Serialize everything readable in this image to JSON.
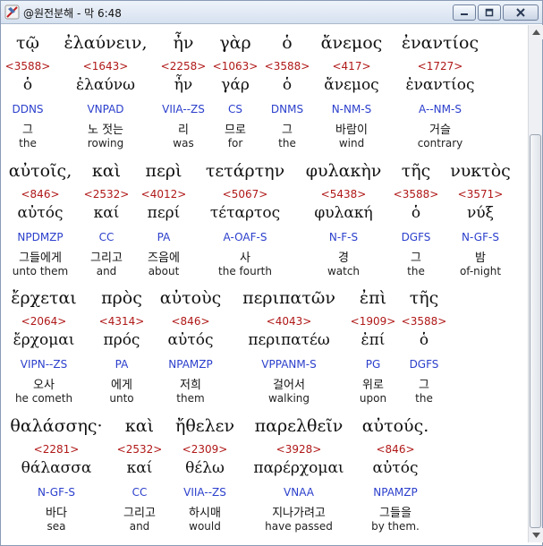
{
  "window": {
    "title": "@원전분해 - 막 6:48",
    "minimize_glyph": "▁",
    "maximize_glyph": "□",
    "close_glyph": "✕"
  },
  "colors": {
    "strong": "#b01818",
    "parsing": "#2b3fcc",
    "text": "#111111"
  },
  "icons": {
    "app": "app-logo-icon",
    "scroll_up": "scroll-up-arrow-icon",
    "scroll_down": "scroll-down-arrow-icon"
  },
  "verse": {
    "rows": [
      {
        "words": [
          {
            "greek": "τῷ",
            "strong": "<3588>",
            "lemma": "ὁ",
            "parse": "DDNS",
            "korean": "그",
            "english": "the"
          },
          {
            "greek": "ἐλαύνειν,",
            "strong": "<1643>",
            "lemma": "ἐλαύνω",
            "parse": "VNPAD",
            "korean": "노 젓는",
            "english": "rowing"
          },
          {
            "greek": "ἦν",
            "strong": "<2258>",
            "lemma": "ἦν",
            "parse": "VIIA--ZS",
            "korean": "리",
            "english": "was"
          },
          {
            "greek": "γὰρ",
            "strong": "<1063>",
            "lemma": "γάρ",
            "parse": "CS",
            "korean": "므로",
            "english": "for"
          },
          {
            "greek": "ὁ",
            "strong": "<3588>",
            "lemma": "ὁ",
            "parse": "DNMS",
            "korean": "그",
            "english": "the"
          },
          {
            "greek": "ἄνεμος",
            "strong": "<417>",
            "lemma": "ἄνεμος",
            "parse": "N-NM-S",
            "korean": "바람이",
            "english": "wind"
          },
          {
            "greek": "ἐναντίος",
            "strong": "<1727>",
            "lemma": "ἐναντίος",
            "parse": "A--NM-S",
            "korean": "거슬",
            "english": "contrary"
          }
        ]
      },
      {
        "words": [
          {
            "greek": "αὐτοῖς,",
            "strong": "<846>",
            "lemma": "αὐτός",
            "parse": "NPDMZP",
            "korean": "그들에게",
            "english": "unto them"
          },
          {
            "greek": "καὶ",
            "strong": "<2532>",
            "lemma": "καί",
            "parse": "CC",
            "korean": "그리고",
            "english": "and"
          },
          {
            "greek": "περὶ",
            "strong": "<4012>",
            "lemma": "περί",
            "parse": "PA",
            "korean": "즈음에",
            "english": "about"
          },
          {
            "greek": "τετάρτην",
            "strong": "<5067>",
            "lemma": "τέταρτος",
            "parse": "A-OAF-S",
            "korean": "사",
            "english": "the fourth"
          },
          {
            "greek": "φυλακὴν",
            "strong": "<5438>",
            "lemma": "φυλακή",
            "parse": "N-F-S",
            "korean": "경",
            "english": "watch"
          },
          {
            "greek": "τῆς",
            "strong": "<3588>",
            "lemma": "ὁ",
            "parse": "DGFS",
            "korean": "그",
            "english": "the"
          },
          {
            "greek": "νυκτὸς",
            "strong": "<3571>",
            "lemma": "νύξ",
            "parse": "N-GF-S",
            "korean": "밤",
            "english": "of-night"
          }
        ]
      },
      {
        "words": [
          {
            "greek": "ἔρχεται",
            "strong": "<2064>",
            "lemma": "ἔρχομαι",
            "parse": "VIPN--ZS",
            "korean": "오사",
            "english": "he cometh"
          },
          {
            "greek": "πρὸς",
            "strong": "<4314>",
            "lemma": "πρός",
            "parse": "PA",
            "korean": "에게",
            "english": "unto"
          },
          {
            "greek": "αὐτοὺς",
            "strong": "<846>",
            "lemma": "αὐτός",
            "parse": "NPAMZP",
            "korean": "저희",
            "english": "them"
          },
          {
            "greek": "περιπατῶν",
            "strong": "<4043>",
            "lemma": "περιπατέω",
            "parse": "VPPANM-S",
            "korean": "걸어서",
            "english": "walking"
          },
          {
            "greek": "ἐπὶ",
            "strong": "<1909>",
            "lemma": "ἐπί",
            "parse": "PG",
            "korean": "위로",
            "english": "upon"
          },
          {
            "greek": "τῆς",
            "strong": "<3588>",
            "lemma": "ὁ",
            "parse": "DGFS",
            "korean": "그",
            "english": "the"
          }
        ]
      },
      {
        "words": [
          {
            "greek": "θαλάσσης·",
            "strong": "<2281>",
            "lemma": "θάλασσα",
            "parse": "N-GF-S",
            "korean": "바다",
            "english": "sea"
          },
          {
            "greek": "καὶ",
            "strong": "<2532>",
            "lemma": "καί",
            "parse": "CC",
            "korean": "그리고",
            "english": "and"
          },
          {
            "greek": "ἤθελεν",
            "strong": "<2309>",
            "lemma": "θέλω",
            "parse": "VIIA--ZS",
            "korean": "하시매",
            "english": "would"
          },
          {
            "greek": "παρελθεῖν",
            "strong": "<3928>",
            "lemma": "παρέρχομαι",
            "parse": "VNAA",
            "korean": "지나가려고",
            "english": "have passed"
          },
          {
            "greek": "αὐτούς.",
            "strong": "<846>",
            "lemma": "αὐτός",
            "parse": "NPAMZP",
            "korean": "그들을",
            "english": "by them."
          }
        ]
      }
    ]
  }
}
